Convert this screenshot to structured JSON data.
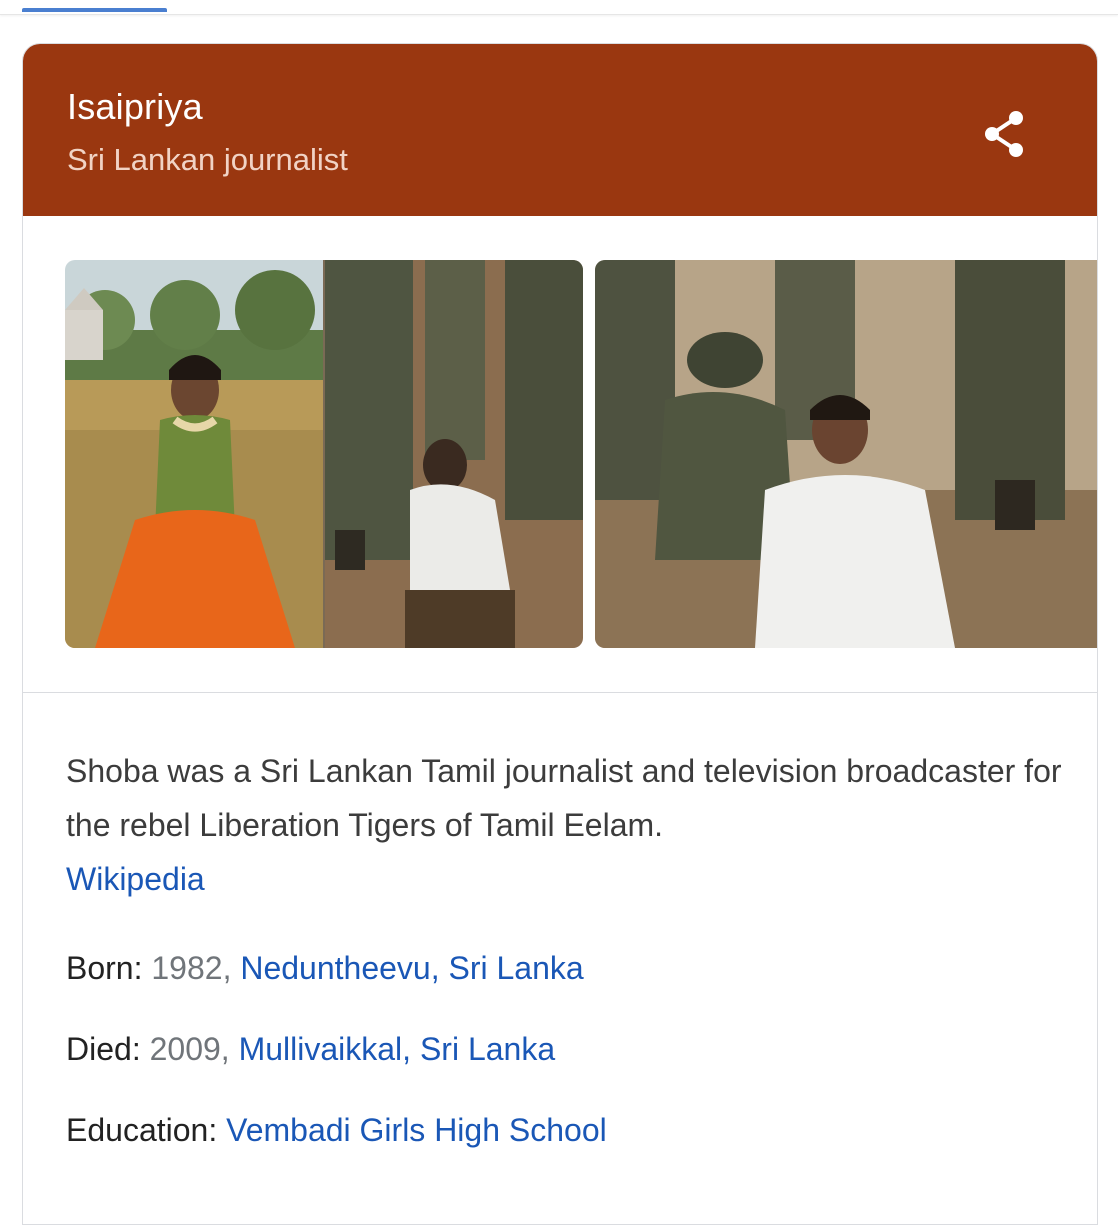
{
  "header": {
    "title": "Isaipriya",
    "subtitle": "Sri Lankan journalist",
    "share_icon": "share-icon",
    "background_color": "#9a3710"
  },
  "images": [
    {
      "label": "photo-collage-field-and-soldiers"
    },
    {
      "label": "photo-woman-with-soldiers"
    }
  ],
  "description": {
    "text": "Shoba was a Sri Lankan Tamil journalist and television broadcaster for the rebel Liberation Tigers of Tamil Eelam.",
    "source_link": "Wikipedia"
  },
  "facts": {
    "born": {
      "label": "Born:",
      "year": "1982",
      "separator": ",",
      "place": "Neduntheevu, Sri Lanka"
    },
    "died": {
      "label": "Died:",
      "year": "2009",
      "separator": ",",
      "place": "Mullivaikkal, Sri Lanka"
    },
    "education": {
      "label": "Education:",
      "value": "Vembadi Girls High School"
    }
  },
  "colors": {
    "link": "#1a57b6",
    "accent_tab": "#4a7fd0"
  }
}
